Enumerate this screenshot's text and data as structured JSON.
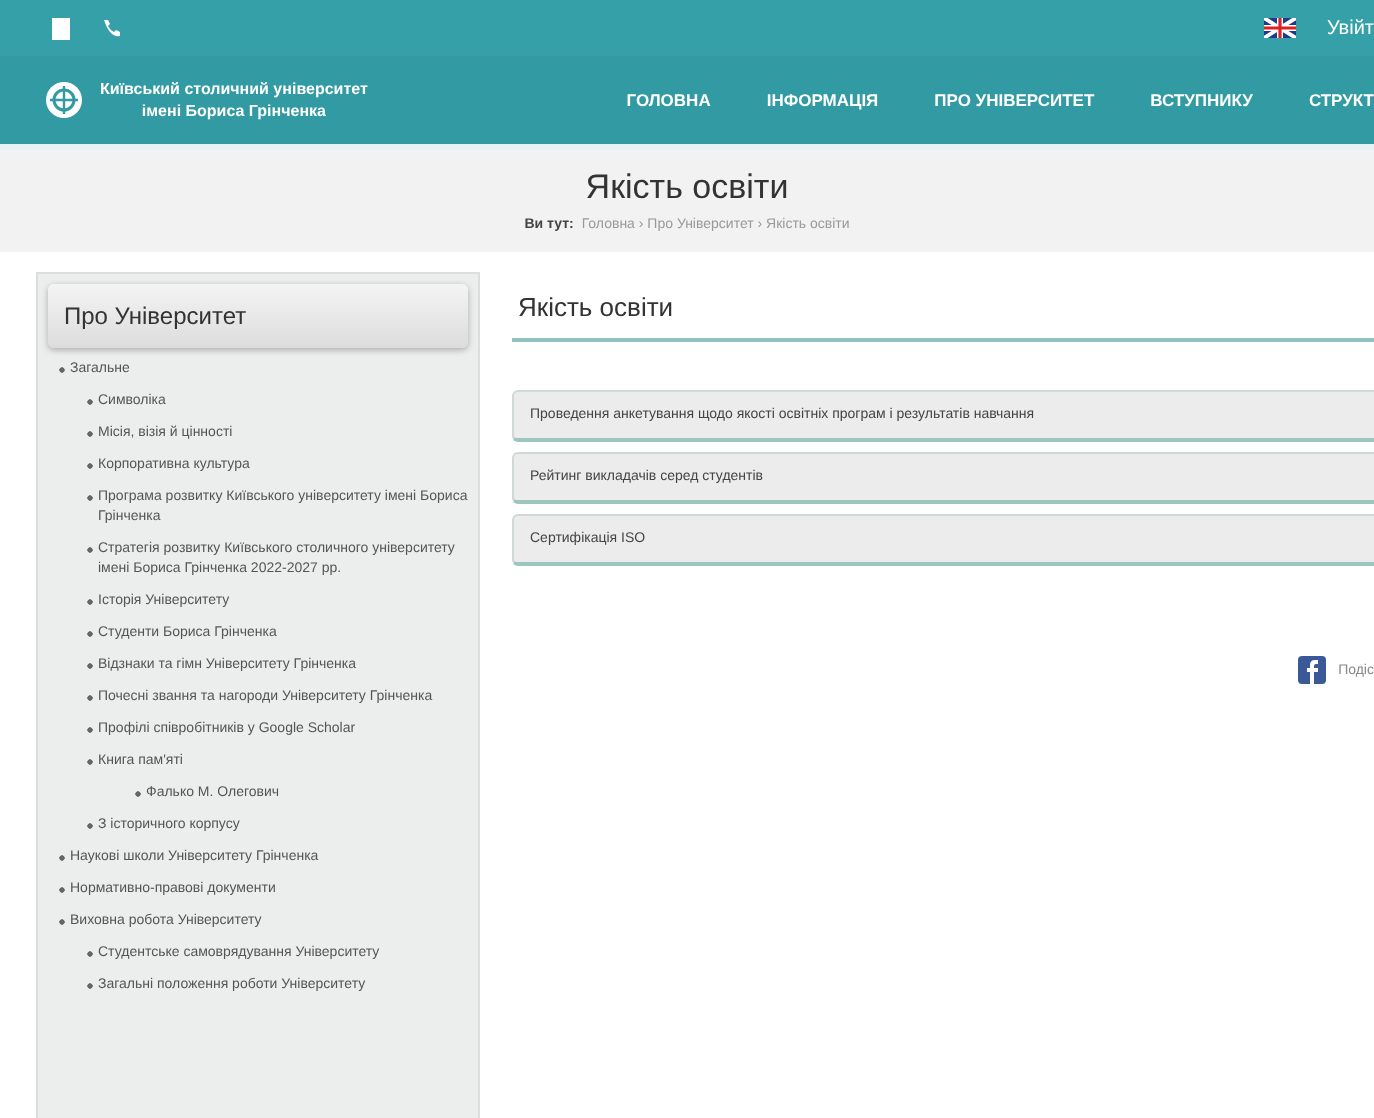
{
  "top_bar": {
    "login": "Увійт"
  },
  "logo": {
    "title": "Київський столичний університет",
    "subtitle": "імені Бориса Грінченка"
  },
  "nav": [
    {
      "label": "ГОЛОВНА"
    },
    {
      "label": "ІНФОРМАЦІЯ"
    },
    {
      "label": "ПРО УНІВЕРСИТЕТ"
    },
    {
      "label": "ВСТУПНИКУ"
    },
    {
      "label": "СТРУКТ"
    }
  ],
  "banner": {
    "title": "Якість освіти",
    "breadcrumb_label": "Ви тут:",
    "breadcrumb": "Головна › Про Університет › Якість освіти"
  },
  "sidebar": {
    "title": "Про Університет",
    "items": [
      {
        "label": "Загальне",
        "children": [
          {
            "label": "Символіка"
          },
          {
            "label": "Місія, візія й цінності"
          },
          {
            "label": "Корпоративна культура"
          },
          {
            "label": "Програма розвитку Київського університету імені Бориса Грінченка"
          },
          {
            "label": "Стратегія розвитку Київського столичного університету імені Бориса Грінченка 2022-2027 рр."
          },
          {
            "label": "Історія Університету"
          },
          {
            "label": "Студенти Бориса Грінченка"
          },
          {
            "label": "Відзнаки та гімн Університету Грінченка"
          },
          {
            "label": "Почесні звання та нагороди Університету Грінченка"
          },
          {
            "label": "Профілі співробітників у Google Scholar"
          },
          {
            "label": "Книга пам'яті",
            "children": [
              {
                "label": "Фалько М. Олегович"
              }
            ]
          },
          {
            "label": "З історичного корпусу"
          }
        ]
      },
      {
        "label": "Наукові школи Університету Грінченка"
      },
      {
        "label": "Нормативно-правові документи"
      },
      {
        "label": "Виховна робота Університету",
        "children": [
          {
            "label": "Студентське самоврядування Університету"
          },
          {
            "label": "Загальні положення роботи Університету"
          }
        ]
      }
    ]
  },
  "content": {
    "title": "Якість освіти",
    "sections": [
      {
        "label": "Проведення анкетування щодо якості освітніх програм і результатів навчання"
      },
      {
        "label": "Рейтинг викладачів серед студентів"
      },
      {
        "label": "Сертифікація ISO"
      }
    ],
    "share": {
      "label": "Подіс"
    }
  }
}
